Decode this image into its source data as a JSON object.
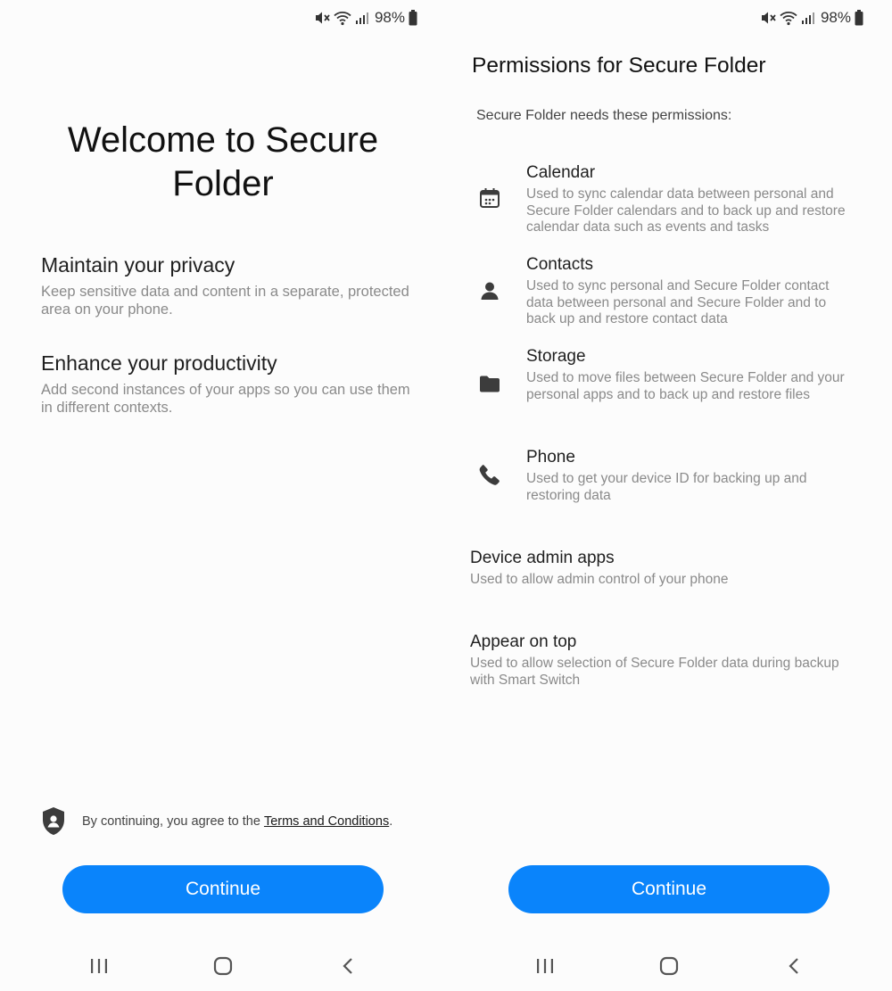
{
  "status_bar": {
    "battery_text": "98%",
    "icons": [
      "mute-icon",
      "wifi-icon",
      "signal-icon",
      "battery-icon"
    ]
  },
  "welcome_screen": {
    "title": "Welcome to Secure Folder",
    "features": [
      {
        "title": "Maintain your privacy",
        "description": "Keep sensitive data and content in a separate, protected area on your phone."
      },
      {
        "title": "Enhance your productivity",
        "description": "Add second instances of your apps so you can use them in different contexts."
      }
    ],
    "terms": {
      "prefix": "By continuing, you agree to the ",
      "link_label": "Terms and Conditions",
      "suffix": "."
    },
    "continue_label": "Continue"
  },
  "permissions_screen": {
    "title": "Permissions for Secure Folder",
    "subtitle": "Secure Folder needs these permissions:",
    "permissions": [
      {
        "name": "Calendar",
        "icon": "calendar-icon",
        "description": "Used to sync calendar data between personal and Secure Folder calendars and to back up and restore calendar data such as events and tasks"
      },
      {
        "name": "Contacts",
        "icon": "person-icon",
        "description": "Used to sync personal and Secure Folder contact data between personal and Secure Folder and to back up and restore contact data"
      },
      {
        "name": "Storage",
        "icon": "folder-icon",
        "description": "Used to move files between Secure Folder and your personal apps and to back up and restore files"
      },
      {
        "name": "Phone",
        "icon": "phone-icon",
        "description": "Used to get your device ID for backing up and restoring data"
      }
    ],
    "extra_permissions": [
      {
        "name": "Device admin apps",
        "description": "Used to allow admin control of your phone"
      },
      {
        "name": "Appear on top",
        "description": "Used to allow selection of Secure Folder data during backup with Smart Switch"
      }
    ],
    "continue_label": "Continue"
  },
  "nav_bar": {
    "icons": [
      "recent-apps-icon",
      "home-icon",
      "back-icon"
    ]
  },
  "colors": {
    "accent": "#0a84fb",
    "secondary_text": "#8a8a8a",
    "primary_text": "#1f1f1f"
  }
}
